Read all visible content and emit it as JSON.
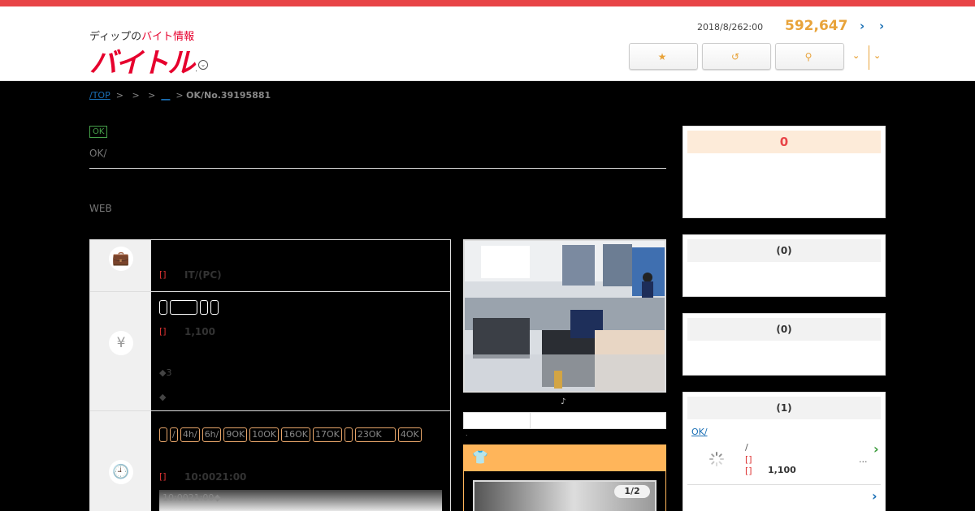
{
  "header": {
    "logo_sub_a": "ディップの",
    "logo_sub_b": "バイト情報",
    "logo_main": "バイトル",
    "logo_dot": ".",
    "date": "2018/8/262:00",
    "count": "592,647",
    "link1": "›",
    "link2": "›",
    "buttons": [
      {
        "label": "",
        "icon": "star-icon"
      },
      {
        "label": "",
        "icon": "history-icon"
      },
      {
        "label": "",
        "icon": "search-icon"
      }
    ],
    "caret": "⌄"
  },
  "breadcrumb": {
    "top": "/TOP",
    "sep": ">",
    "link": "__",
    "current": "OK/No.39195881"
  },
  "title_block": {
    "badge": "OK",
    "subtitle": "OK/",
    "web": "WEB"
  },
  "table": {
    "row1": {
      "label": "[]",
      "value": "IT/(PC)"
    },
    "row2": {
      "tags": [
        "",
        "",
        "",
        ""
      ],
      "label": "[]",
      "value": "1,100",
      "note1": "◆3",
      "note2": "◆"
    },
    "row3": {
      "tags": [
        "",
        "/",
        "4h/",
        "6h/",
        "9OK",
        "10OK",
        "16OK",
        "17OK",
        "",
        "23OK",
        "4OK"
      ],
      "label": "[]",
      "value": "10:0021:00",
      "fade_text": "10:0021:00◆"
    }
  },
  "photo_note": "♪",
  "gallery": {
    "pager": "1/2"
  },
  "sidebar": {
    "box1": {
      "title": "0"
    },
    "box2": {
      "title": "(0)"
    },
    "box3": {
      "title": "(0)"
    },
    "box4": {
      "title": "(1)",
      "link": "OK/",
      "slash": "/",
      "lbl1": "[]",
      "lbl2": "[]",
      "wage": "1,100",
      "ellipsis": "...",
      "more": "›"
    }
  }
}
